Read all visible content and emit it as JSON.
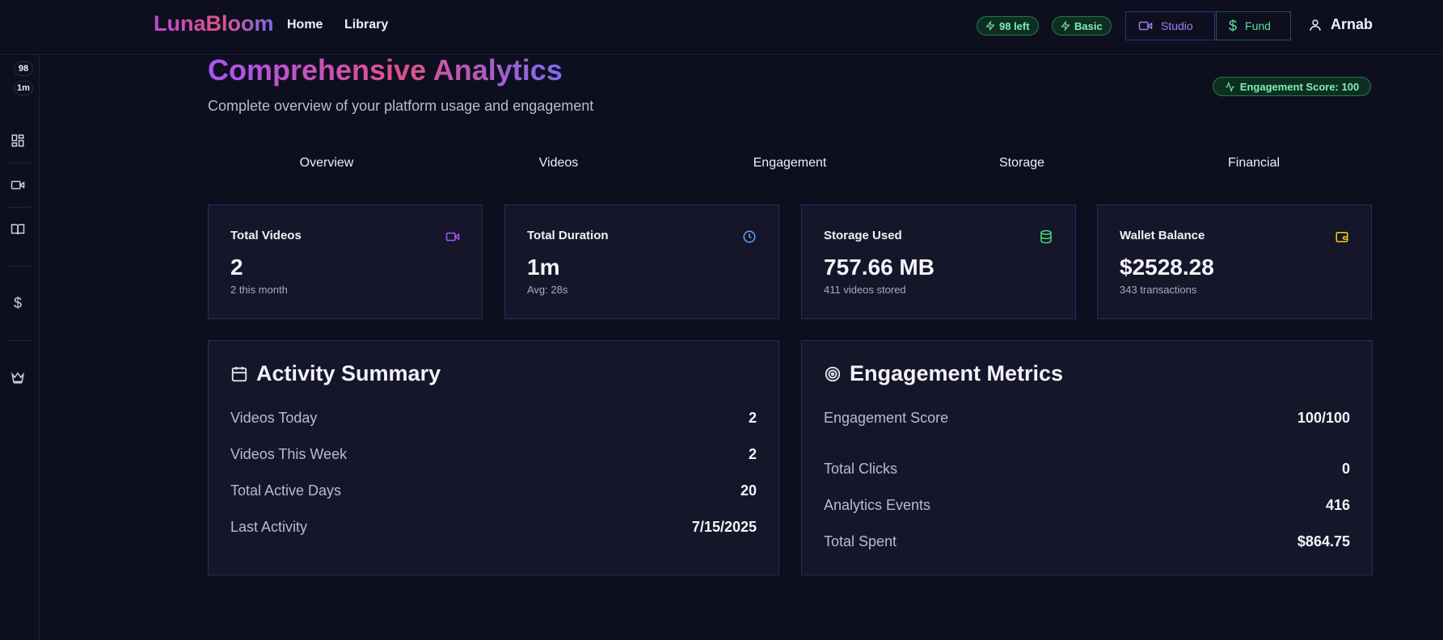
{
  "header": {
    "logo": "LunaBloom",
    "nav": [
      "Home",
      "Library"
    ],
    "credits_pill": "98 left",
    "plan_pill": "Basic",
    "studio_label": "Studio",
    "fund_label": "Fund",
    "user_name": "Arnab"
  },
  "sidebar": {
    "badge_count": "98",
    "badge_time": "1m"
  },
  "page": {
    "title": "Comprehensive Analytics",
    "subtitle": "Complete overview of your platform usage and engagement",
    "engagement_badge": "Engagement Score: 100"
  },
  "tabs": [
    "Overview",
    "Videos",
    "Engagement",
    "Storage",
    "Financial"
  ],
  "stats": [
    {
      "label": "Total Videos",
      "value": "2",
      "sub": "2 this month",
      "icon": "video-icon",
      "color": "#a855f7"
    },
    {
      "label": "Total Duration",
      "value": "1m",
      "sub": "Avg: 28s",
      "icon": "clock-icon",
      "color": "#60a5fa"
    },
    {
      "label": "Storage Used",
      "value": "757.66 MB",
      "sub": "411 videos stored",
      "icon": "database-icon",
      "color": "#4ade80"
    },
    {
      "label": "Wallet Balance",
      "value": "$2528.28",
      "sub": "343 transactions",
      "icon": "wallet-icon",
      "color": "#facc15"
    }
  ],
  "activity": {
    "title": "Activity Summary",
    "rows": [
      {
        "k": "Videos Today",
        "v": "2"
      },
      {
        "k": "Videos This Week",
        "v": "2"
      },
      {
        "k": "Total Active Days",
        "v": "20"
      },
      {
        "k": "Last Activity",
        "v": "7/15/2025"
      }
    ]
  },
  "engagement": {
    "title": "Engagement Metrics",
    "rows": [
      {
        "k": "Engagement Score",
        "v": "100/100"
      },
      {
        "k": "Total Clicks",
        "v": "0"
      },
      {
        "k": "Analytics Events",
        "v": "416"
      },
      {
        "k": "Total Spent",
        "v": "$864.75"
      }
    ]
  }
}
